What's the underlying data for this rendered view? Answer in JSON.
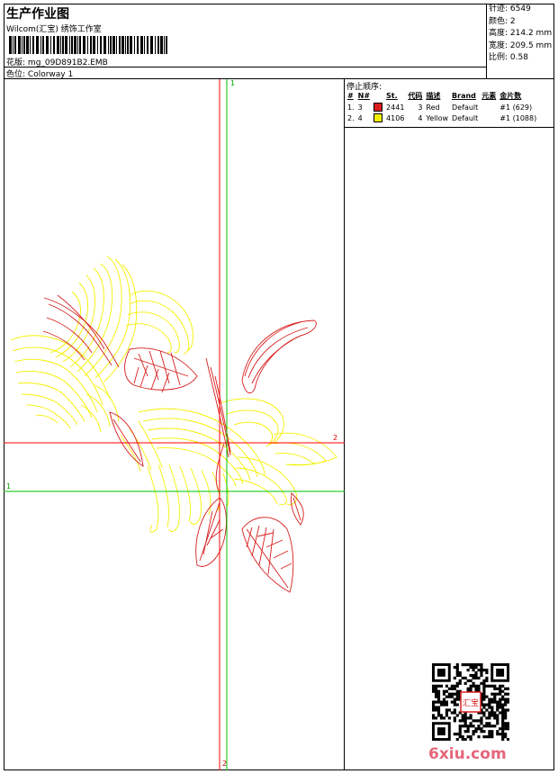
{
  "header": {
    "title": "生产作业图",
    "subtitle": "Wilcom(汇宝) 绣饰工作室",
    "design_label": "花版:",
    "design_file": "mg_09D891B2.EMB",
    "colorway_label": "色位:",
    "colorway": "Colorway 1"
  },
  "stats": [
    {
      "label": "针迹:",
      "value": "6549"
    },
    {
      "label": "颜色:",
      "value": "2"
    },
    {
      "label": "高度:",
      "value": "214.2 mm"
    },
    {
      "label": "宽度:",
      "value": "209.5 mm"
    },
    {
      "label": "比例:",
      "value": "0.58"
    }
  ],
  "stop_sequence": {
    "label": "停止顺序:",
    "columns": [
      "#",
      "N#",
      "St.",
      "代码",
      "描述",
      "Brand",
      "元素",
      "金片数"
    ],
    "rows": [
      {
        "num": "1.",
        "n": "3",
        "color": "#d81e1e",
        "st": "2441",
        "code": "3",
        "desc": "Red",
        "brand": "Default",
        "elem": "",
        "seq": "#1 (629)"
      },
      {
        "num": "2.",
        "n": "4",
        "color": "#f4f000",
        "st": "4106",
        "code": "4",
        "desc": "Yellow",
        "brand": "Default",
        "elem": "",
        "seq": "#1 (1088)"
      }
    ]
  },
  "axes": {
    "top_label": "1",
    "right_label": "2",
    "left_label": "1",
    "bottom_label": "2"
  },
  "colors": {
    "thread_red": "#d81e1e",
    "thread_yellow": "#f4f000",
    "axis_red": "#ff0000",
    "axis_green": "#00c000"
  },
  "watermark": "6xiu.com",
  "qr_stamp": "汇宝"
}
